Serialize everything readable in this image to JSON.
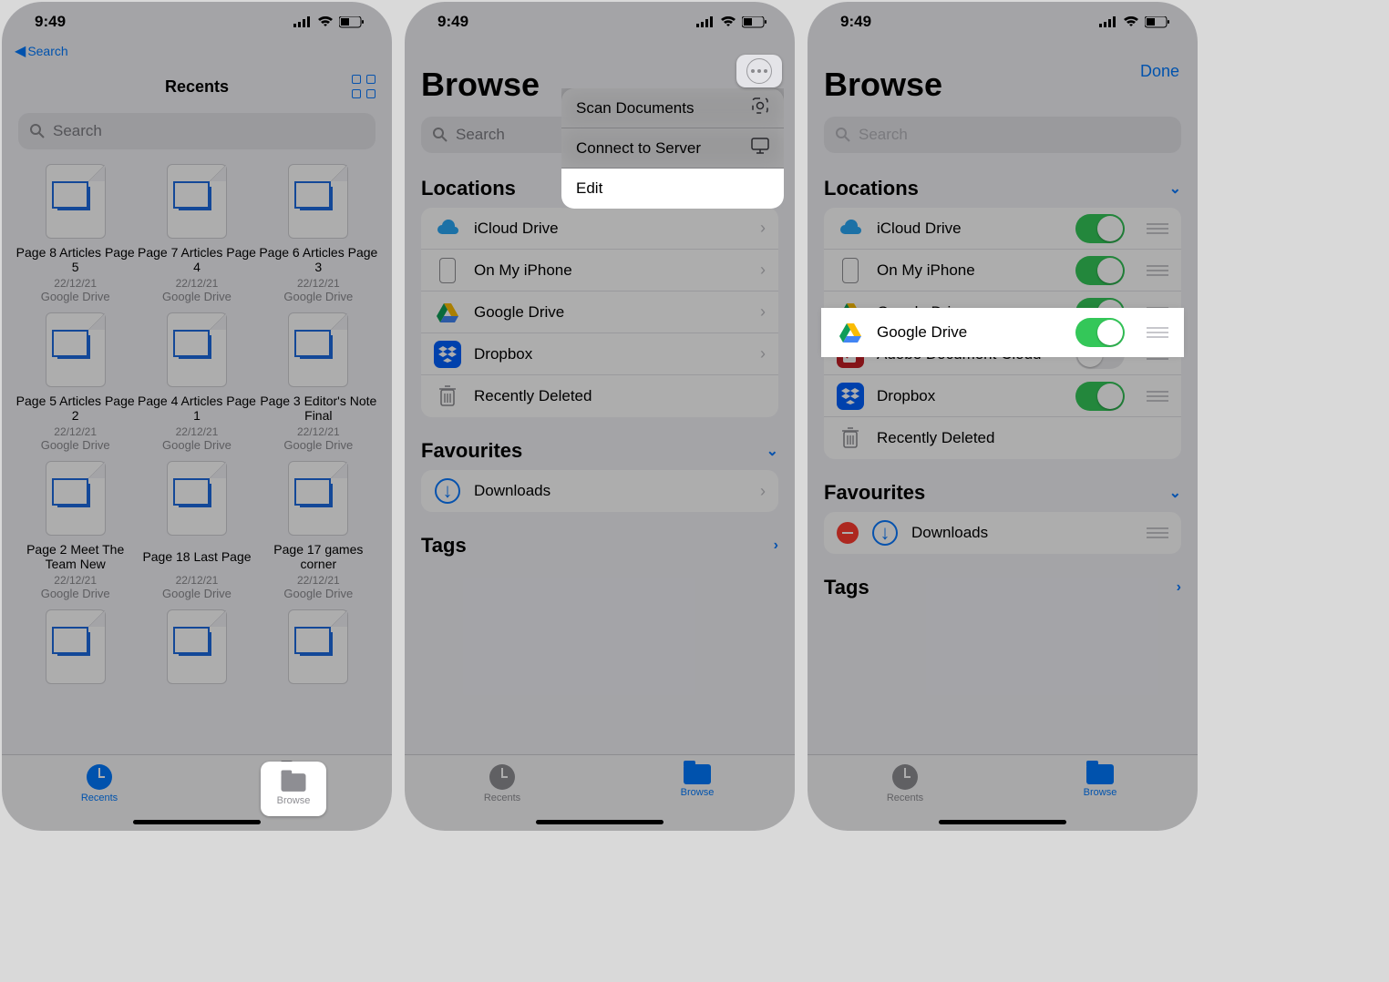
{
  "status": {
    "time": "9:49"
  },
  "screen1": {
    "back": "Search",
    "title": "Recents",
    "search_placeholder": "Search",
    "files": [
      {
        "title": "Page 8 Articles Page 5",
        "date": "22/12/21",
        "loc": "Google Drive"
      },
      {
        "title": "Page 7 Articles Page 4",
        "date": "22/12/21",
        "loc": "Google Drive"
      },
      {
        "title": "Page 6 Articles Page 3",
        "date": "22/12/21",
        "loc": "Google Drive"
      },
      {
        "title": "Page 5 Articles Page 2",
        "date": "22/12/21",
        "loc": "Google Drive"
      },
      {
        "title": "Page 4 Articles Page 1",
        "date": "22/12/21",
        "loc": "Google Drive"
      },
      {
        "title": "Page 3 Editor's Note Final",
        "date": "22/12/21",
        "loc": "Google Drive"
      },
      {
        "title": "Page 2 Meet The Team New",
        "date": "22/12/21",
        "loc": "Google Drive"
      },
      {
        "title": "Page 18 Last Page",
        "date": "22/12/21",
        "loc": "Google Drive"
      },
      {
        "title": "Page 17 games corner",
        "date": "22/12/21",
        "loc": "Google Drive"
      }
    ],
    "tabs": {
      "recents": "Recents",
      "browse": "Browse"
    }
  },
  "screen2": {
    "title": "Browse",
    "search_placeholder": "Search",
    "menu": {
      "scan": "Scan Documents",
      "connect": "Connect to Server",
      "edit": "Edit"
    },
    "sections": {
      "locations": "Locations",
      "favourites": "Favourites",
      "tags": "Tags"
    },
    "locations": [
      {
        "label": "iCloud Drive"
      },
      {
        "label": "On My iPhone"
      },
      {
        "label": "Google Drive"
      },
      {
        "label": "Dropbox"
      },
      {
        "label": "Recently Deleted"
      }
    ],
    "favourites": [
      {
        "label": "Downloads"
      }
    ],
    "tabs": {
      "recents": "Recents",
      "browse": "Browse"
    }
  },
  "screen3": {
    "title": "Browse",
    "done": "Done",
    "search_placeholder": "Search",
    "sections": {
      "locations": "Locations",
      "favourites": "Favourites",
      "tags": "Tags"
    },
    "locations": [
      {
        "label": "iCloud Drive",
        "on": true
      },
      {
        "label": "On My iPhone",
        "on": true
      },
      {
        "label": "Google Drive",
        "on": true
      },
      {
        "label": "Adobe Document Cloud",
        "on": false
      },
      {
        "label": "Dropbox",
        "on": true
      },
      {
        "label": "Recently Deleted"
      }
    ],
    "favourites": [
      {
        "label": "Downloads"
      }
    ],
    "tabs": {
      "recents": "Recents",
      "browse": "Browse"
    }
  }
}
